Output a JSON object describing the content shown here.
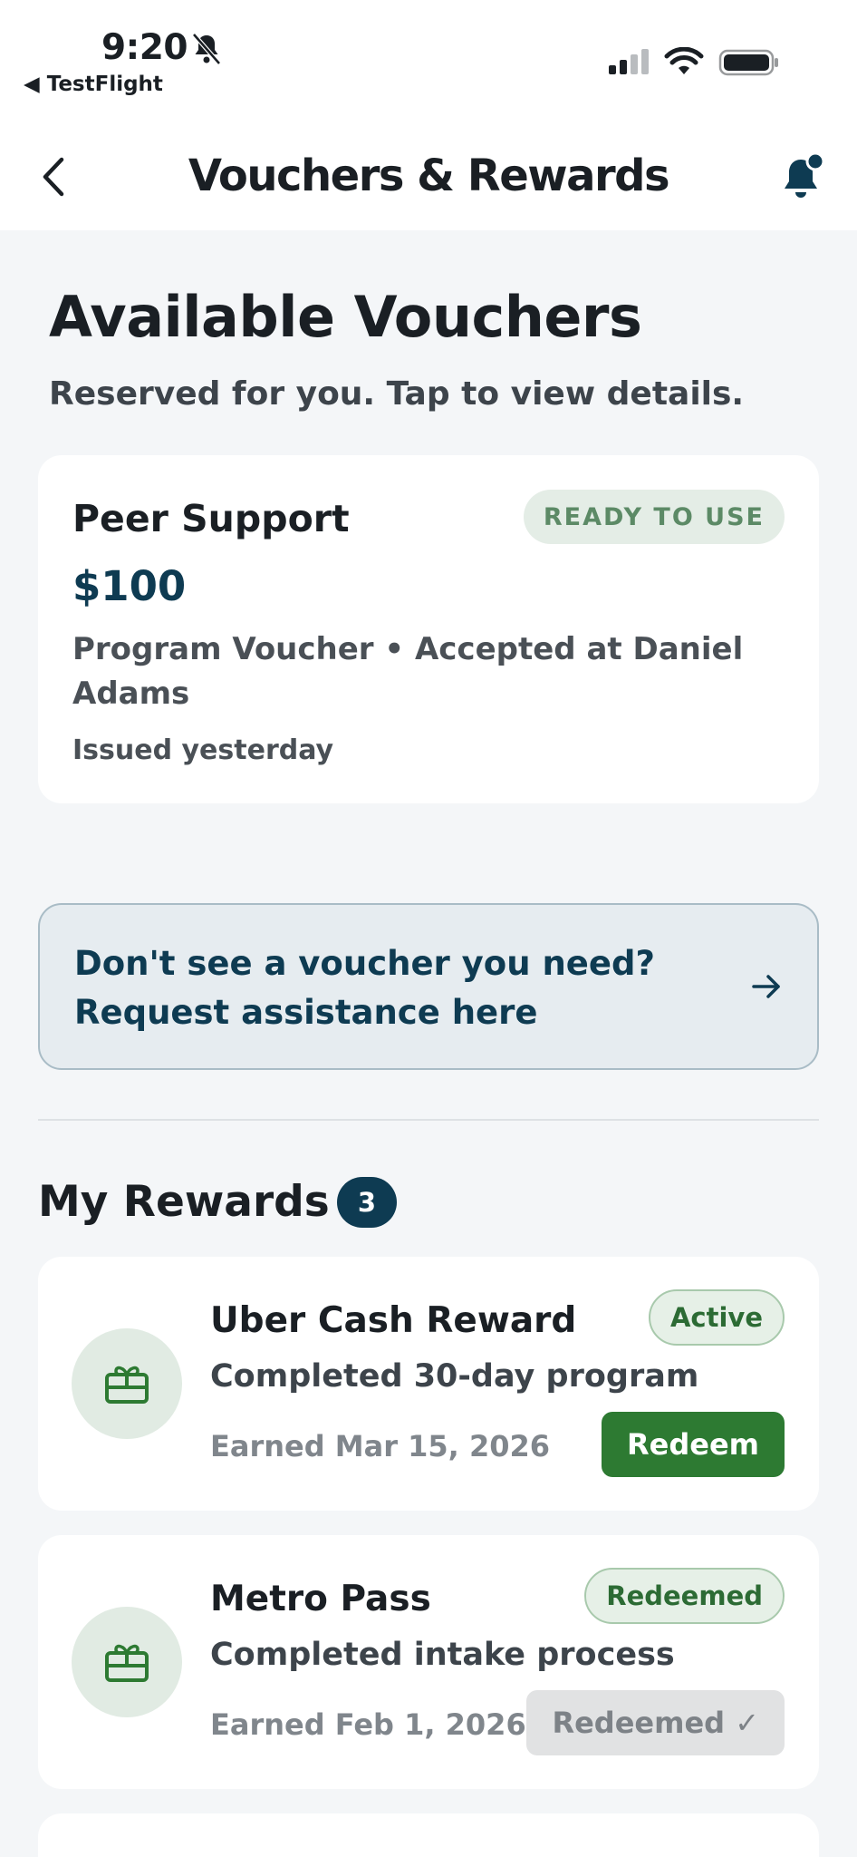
{
  "status_bar": {
    "time": "9:20",
    "back_app": "◀ TestFlight"
  },
  "nav": {
    "title": "Vouchers & Rewards"
  },
  "vouchers": {
    "title": "Available Vouchers",
    "subtitle": "Reserved for you. Tap to view details.",
    "items": [
      {
        "name": "Peer Support",
        "badge": "READY TO USE",
        "amount": "$100",
        "description": "Program Voucher • Accepted at Daniel Adams",
        "issued": "Issued yesterday"
      }
    ]
  },
  "assistance": {
    "line1": "Don't see a voucher you need?",
    "line2": "Request assistance here"
  },
  "rewards": {
    "title": "My Rewards",
    "count": "3",
    "items": [
      {
        "name": "Uber Cash Reward",
        "status": "Active",
        "description": "Completed 30-day program",
        "earned": "Earned Mar 15, 2026",
        "button": "Redeem"
      },
      {
        "name": "Metro Pass",
        "status": "Redeemed",
        "description": "Completed intake process",
        "earned": "Earned Feb 1, 2026",
        "button": "Redeemed ✓"
      }
    ]
  },
  "colors": {
    "brand_navy": "#0e3b52",
    "reward_green": "#2d7a32",
    "background": "#f4f6f8"
  }
}
